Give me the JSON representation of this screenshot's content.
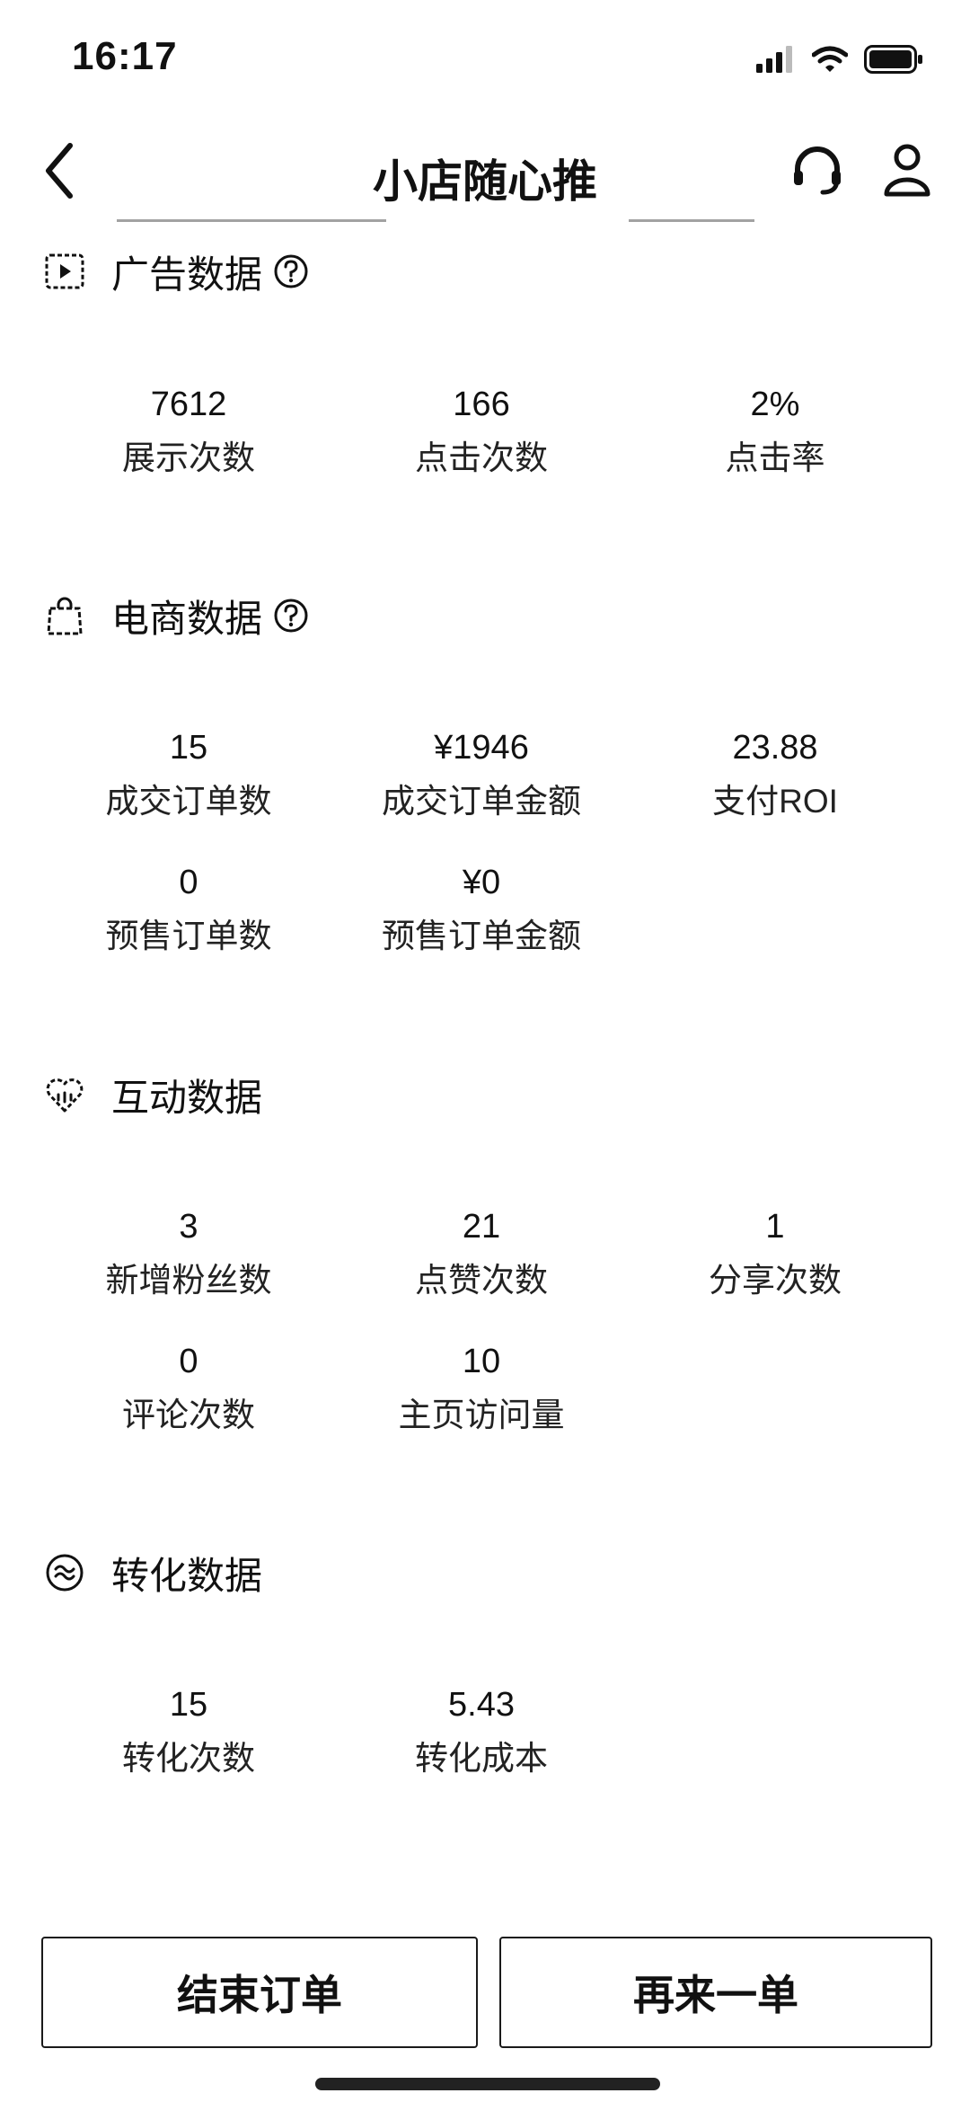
{
  "status_bar": {
    "time": "16:17"
  },
  "nav": {
    "title": "小店随心推"
  },
  "sections": {
    "ad": {
      "title": "广告数据",
      "stats": [
        {
          "value": "7612",
          "label": "展示次数"
        },
        {
          "value": "166",
          "label": "点击次数"
        },
        {
          "value": "2%",
          "label": "点击率"
        }
      ]
    },
    "ecommerce": {
      "title": "电商数据",
      "stats": [
        {
          "value": "15",
          "label": "成交订单数"
        },
        {
          "value": "¥1946",
          "label": "成交订单金额"
        },
        {
          "value": "23.88",
          "label": "支付ROI"
        },
        {
          "value": "0",
          "label": "预售订单数"
        },
        {
          "value": "¥0",
          "label": "预售订单金额"
        }
      ]
    },
    "interaction": {
      "title": "互动数据",
      "stats": [
        {
          "value": "3",
          "label": "新增粉丝数"
        },
        {
          "value": "21",
          "label": "点赞次数"
        },
        {
          "value": "1",
          "label": "分享次数"
        },
        {
          "value": "0",
          "label": "评论次数"
        },
        {
          "value": "10",
          "label": "主页访问量"
        }
      ]
    },
    "conversion": {
      "title": "转化数据",
      "stats": [
        {
          "value": "15",
          "label": "转化次数"
        },
        {
          "value": "5.43",
          "label": "转化成本"
        }
      ]
    }
  },
  "buttons": {
    "end_order": "结束订单",
    "reorder": "再来一单"
  }
}
